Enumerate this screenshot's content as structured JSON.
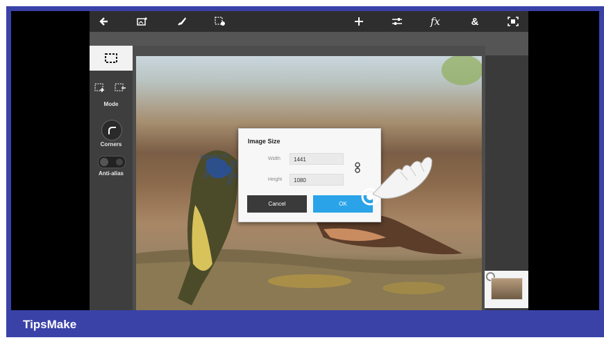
{
  "watermark": "TipsMake",
  "brand": {
    "text": "TipsMake"
  },
  "toolbar": {
    "icons": [
      "back-arrow-icon",
      "add-image-icon",
      "brush-icon",
      "selection-settings-icon",
      "plus-icon",
      "adjustments-icon",
      "effects-icon",
      "blend-icon",
      "crop-fit-icon"
    ],
    "fx_label": "fx",
    "amp_label": "&"
  },
  "left_panel": {
    "mode_label": "Mode",
    "corners_label": "Corners",
    "antialias_label": "Anti-alias"
  },
  "dialog": {
    "title": "Image Size",
    "width_label": "Width",
    "width_value": "1441",
    "height_label": "Height",
    "height_value": "1080",
    "cancel_label": "Cancel",
    "ok_label": "OK"
  },
  "colors": {
    "frame": "#3a42a8",
    "ok_button": "#2aa3e8",
    "cancel_button": "#3a3a3a"
  }
}
